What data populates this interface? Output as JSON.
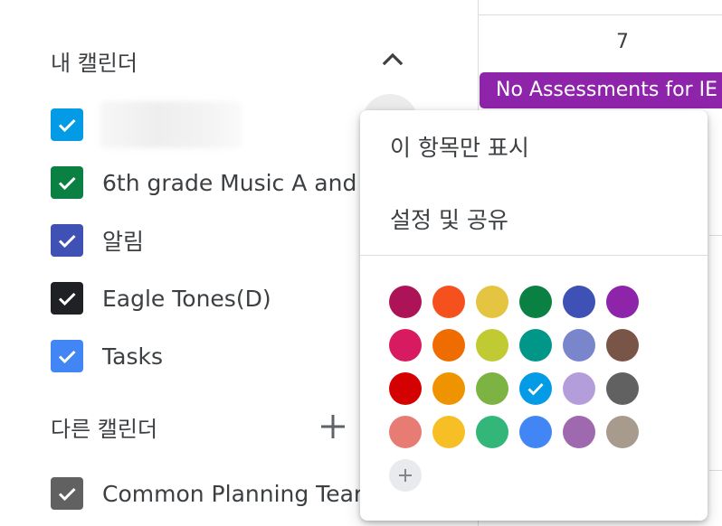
{
  "sidebar": {
    "my_calendars_label": "내 캘린더",
    "other_calendars_label": "다른 캘린더",
    "my_calendars": [
      {
        "label": "",
        "color": "#039be5",
        "checked": true,
        "blurred": true
      },
      {
        "label": "6th grade Music A and",
        "color": "#0b8043",
        "checked": true
      },
      {
        "label": "알림",
        "color": "#3f51b5",
        "checked": true
      },
      {
        "label": "Eagle Tones(D)",
        "color": "#202124",
        "checked": true
      },
      {
        "label": "Tasks",
        "color": "#4285f4",
        "checked": true
      }
    ],
    "other_calendars": [
      {
        "label": "Common Planning Tear",
        "color": "#616161",
        "checked": true
      }
    ]
  },
  "calendar_view": {
    "day_number": "7",
    "event_title": "No Assessments for IE",
    "event_color": "#8e24aa"
  },
  "context_menu": {
    "items": [
      {
        "label": "이 항목만 표시"
      },
      {
        "label": "설정 및 공유"
      }
    ],
    "colors": [
      [
        "#ad1457",
        "#f4511e",
        "#e4c441",
        "#0b8043",
        "#3f51b5",
        "#8e24aa"
      ],
      [
        "#d81b60",
        "#ef6c00",
        "#c0ca33",
        "#009688",
        "#7986cb",
        "#795548"
      ],
      [
        "#d50000",
        "#f09300",
        "#7cb342",
        "#039be5",
        "#b39ddb",
        "#616161"
      ],
      [
        "#e67c73",
        "#f6bf26",
        "#33b679",
        "#4285f4",
        "#9e69af",
        "#a79b8e"
      ]
    ],
    "selected_color": "#039be5"
  }
}
